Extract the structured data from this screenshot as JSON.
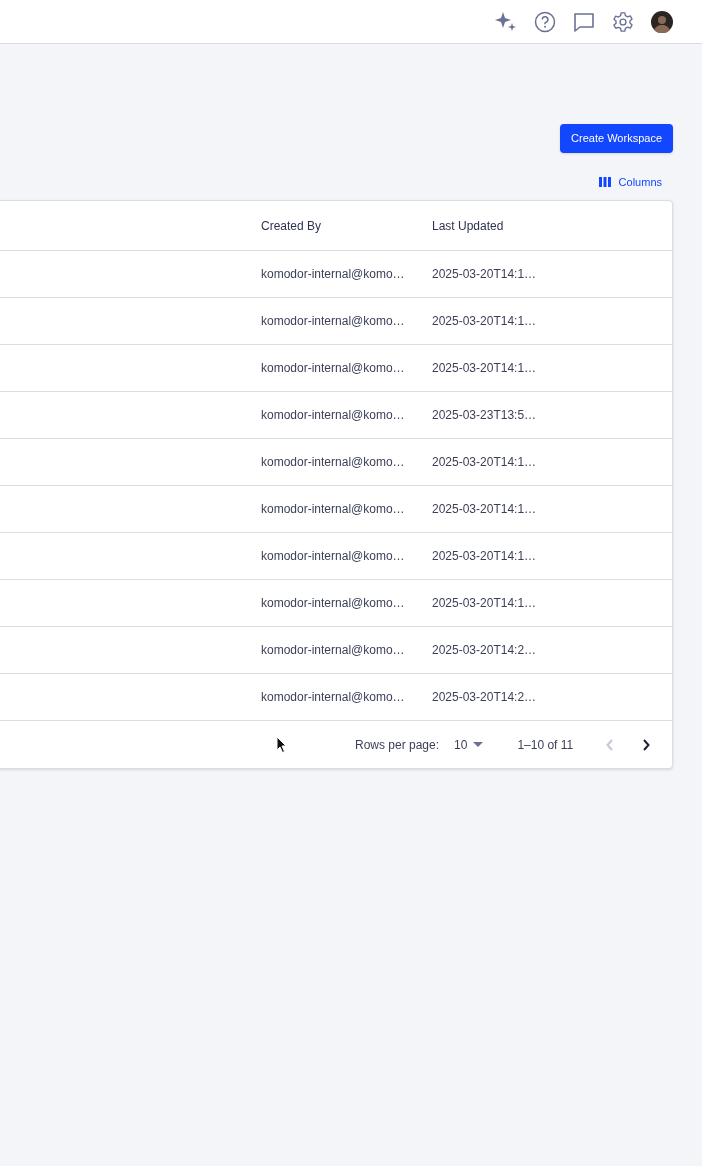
{
  "create_button": "Create Workspace",
  "columns_button": "Columns",
  "table": {
    "columns": [
      "Created By",
      "Last Updated"
    ],
    "rows": [
      {
        "created_by": "komodor-internal@komo…",
        "last_updated": "2025-03-20T14:1…"
      },
      {
        "created_by": "komodor-internal@komo…",
        "last_updated": "2025-03-20T14:1…"
      },
      {
        "created_by": "komodor-internal@komo…",
        "last_updated": "2025-03-20T14:1…"
      },
      {
        "created_by": "komodor-internal@komo…",
        "last_updated": "2025-03-23T13:5…"
      },
      {
        "created_by": "komodor-internal@komo…",
        "last_updated": "2025-03-20T14:1…"
      },
      {
        "created_by": "komodor-internal@komo…",
        "last_updated": "2025-03-20T14:1…"
      },
      {
        "created_by": "komodor-internal@komo…",
        "last_updated": "2025-03-20T14:1…"
      },
      {
        "created_by": "komodor-internal@komo…",
        "last_updated": "2025-03-20T14:1…"
      },
      {
        "created_by": "komodor-internal@komo…",
        "last_updated": "2025-03-20T14:2…"
      },
      {
        "created_by": "komodor-internal@komo…",
        "last_updated": "2025-03-20T14:2…"
      }
    ]
  },
  "pagination": {
    "rows_per_page_label": "Rows per page:",
    "rows_per_page": "10",
    "range": "1–10 of 11",
    "previous_disabled": true,
    "next_disabled": false
  }
}
